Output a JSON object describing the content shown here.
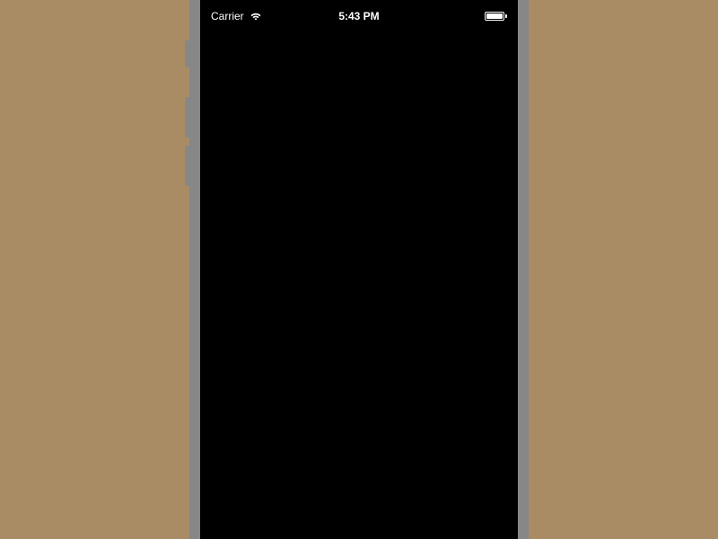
{
  "status_bar": {
    "carrier": "Carrier",
    "time": "5:43 PM",
    "wifi_icon": "wifi-icon",
    "battery_icon": "battery-icon",
    "battery_level": 100
  }
}
